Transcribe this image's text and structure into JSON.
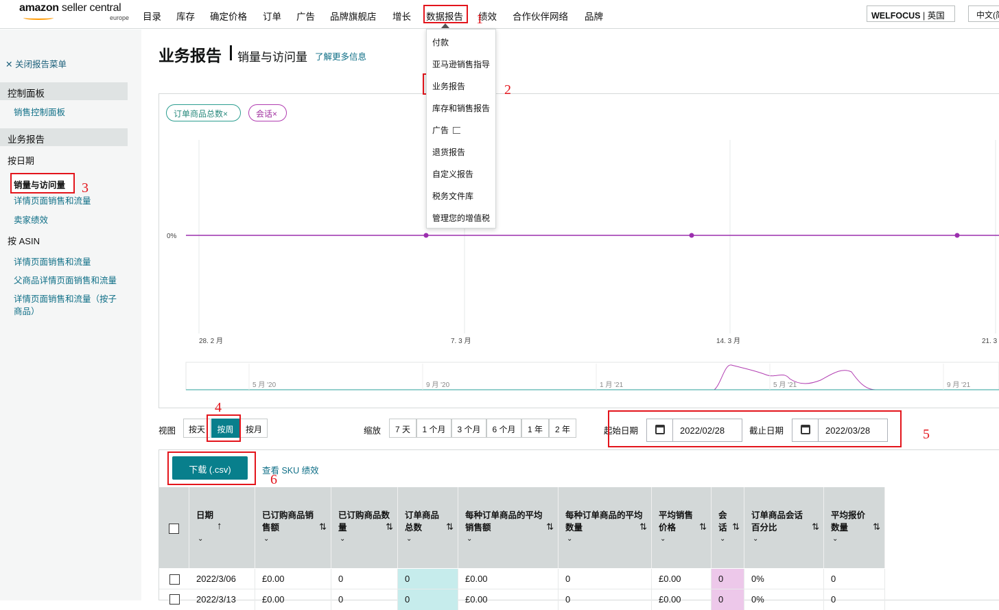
{
  "brand": {
    "logo_main": "amazon",
    "logo_suffix": " seller central",
    "logo_region": "europe"
  },
  "nav": {
    "items": [
      "目录",
      "库存",
      "确定价格",
      "订单",
      "广告",
      "品牌旗舰店",
      "增长",
      "数据报告",
      "绩效",
      "合作伙伴网络",
      "品牌"
    ],
    "account_store": "WELFOCUS",
    "account_region": " | 英国",
    "language": "中文(简"
  },
  "dropdown": {
    "items": [
      "付款",
      "亚马逊销售指导",
      "业务报告",
      "库存和销售报告",
      "广告",
      "退货报告",
      "自定义报告",
      "税务文件库",
      "管理您的增值税"
    ]
  },
  "sidebar": {
    "close": "关闭报告菜单",
    "section1": "控制面板",
    "link_dashboard": "销售控制面板",
    "section2": "业务报告",
    "by_date": "按日期",
    "active": "销量与访问量",
    "link_detail": "详情页面销售和流量",
    "link_seller": "卖家绩效",
    "by_asin": "按 ASIN",
    "asin_links": [
      "详情页面销售和流量",
      "父商品详情页面销售和流量",
      "详情页面销售和流量（按子商品）"
    ]
  },
  "header": {
    "title": "业务报告",
    "subtitle": "销量与访问量",
    "learn_more": "了解更多信息"
  },
  "chips": {
    "units": "订单商品总数",
    "sessions": "会话",
    "remove": "×"
  },
  "chart_data": {
    "type": "line",
    "y_tick": "0%",
    "x_ticks": [
      "28. 2 月",
      "7. 3 月",
      "14. 3 月",
      "21. 3"
    ],
    "series": [
      {
        "color": "#9b2fae",
        "values": [
          0,
          0,
          0,
          0,
          0
        ]
      }
    ],
    "navigator_ticks": [
      "5 月 '20",
      "9 月 '20",
      "1 月 '21",
      "5 月 '21",
      "9 月 '21"
    ],
    "colors": {
      "sessions": "#9b2fae",
      "units": "#2aa198"
    }
  },
  "annotations": [
    "1",
    "2",
    "3",
    "4",
    "5",
    "6"
  ],
  "controls": {
    "view_label": "视图",
    "view_options": [
      "按天",
      "按周",
      "按月"
    ],
    "zoom_label": "缩放",
    "zoom_options": [
      "7 天",
      "1 个月",
      "3 个月",
      "6 个月",
      "1 年",
      "2 年"
    ],
    "start_label": "起始日期",
    "start_value": "2022/02/28",
    "end_label": "截止日期",
    "end_value": "2022/03/28"
  },
  "actions": {
    "download": "下载 (.csv)",
    "sku": "查看 SKU 绩效"
  },
  "table": {
    "headers": [
      "日期",
      "已订购商品销售额",
      "已订购商品数量",
      "订单商品总数",
      "每种订单商品的平均销售额",
      "每种订单商品的平均数量",
      "平均销售价格",
      "会话",
      "订单商品会话百分比",
      "平均报价数量"
    ],
    "rows": [
      [
        "2022/3/06",
        "£0.00",
        "0",
        "0",
        "£0.00",
        "0",
        "£0.00",
        "0",
        "0%",
        "0"
      ],
      [
        "2022/3/13",
        "£0.00",
        "0",
        "0",
        "£0.00",
        "0",
        "£0.00",
        "0",
        "0%",
        "0"
      ]
    ]
  }
}
